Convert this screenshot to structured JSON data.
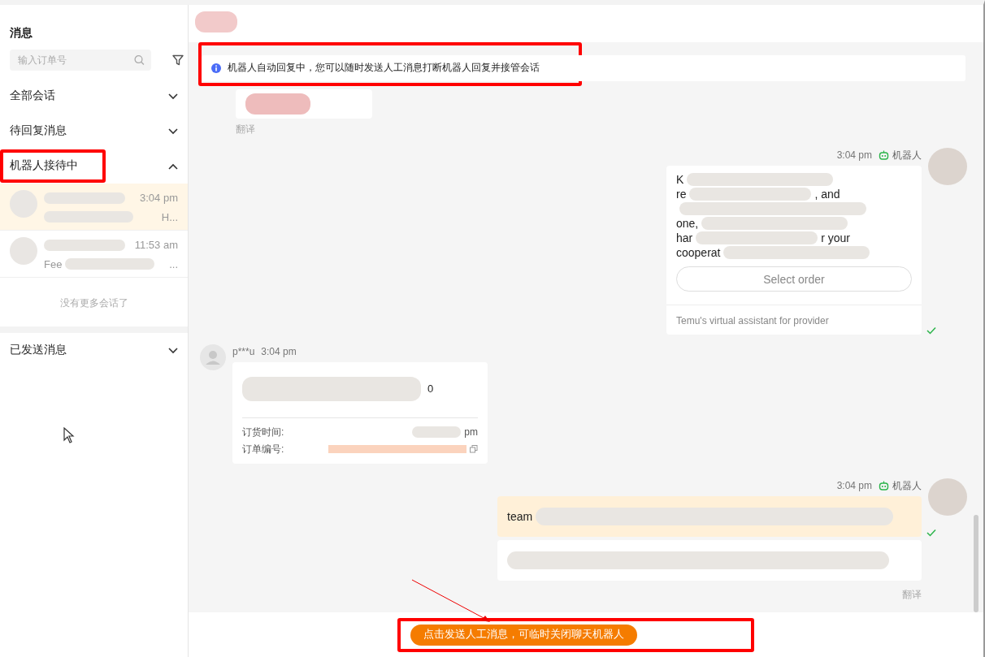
{
  "sidebar": {
    "title": "消息",
    "search": {
      "placeholder": "输入订单号"
    },
    "sections": [
      {
        "label": "全部会话",
        "expanded": false,
        "annotated": false
      },
      {
        "label": "待回复消息",
        "expanded": false,
        "annotated": false
      },
      {
        "label": "机器人接待中",
        "expanded": true,
        "annotated": true,
        "conversations": [
          {
            "time": "3:04 pm",
            "preview_end": "H...",
            "selected": true
          },
          {
            "time": "11:53 am",
            "preview_start": "Fee",
            "preview_end": "...",
            "selected": false
          }
        ],
        "end_note": "没有更多会话了"
      },
      {
        "label": "已发送消息",
        "expanded": false,
        "annotated": false
      }
    ]
  },
  "chat": {
    "notice": {
      "text": "机器人自动回复中，您可以随时发送人工消息打断机器人回复并接管会话",
      "annotated": true
    },
    "messages": [
      {
        "kind": "incoming-partial",
        "translate": "翻译"
      },
      {
        "kind": "bot",
        "time": "3:04 pm",
        "sender": "机器人",
        "lines": [
          {
            "kind": "text",
            "start": "K"
          },
          {
            "kind": "text",
            "start": "re",
            "end": ", and"
          },
          {
            "kind": "blurred"
          },
          {
            "kind": "text",
            "start": "one,"
          },
          {
            "kind": "text",
            "start": "har",
            "end": "r your"
          },
          {
            "kind": "text",
            "start": "cooperat"
          }
        ],
        "button": "Select order",
        "footer": "Temu's virtual assistant for provider",
        "delivered": true
      },
      {
        "kind": "order",
        "sender": "p***u",
        "time": "3:04 pm",
        "summary_end": "0",
        "fields": [
          {
            "label": "订货时间:",
            "value_end": "pm"
          },
          {
            "label": "订单编号:"
          }
        ]
      },
      {
        "kind": "bot-plain",
        "time": "3:04 pm",
        "sender": "机器人",
        "bubbles": [
          {
            "highlight": true,
            "fragment": "team"
          },
          {
            "highlight": false
          }
        ],
        "delivered": true,
        "translate": "翻译"
      }
    ],
    "action": {
      "label": "点击发送人工消息，可临时关闭聊天机器人",
      "annotated": true,
      "arrow": true
    }
  }
}
